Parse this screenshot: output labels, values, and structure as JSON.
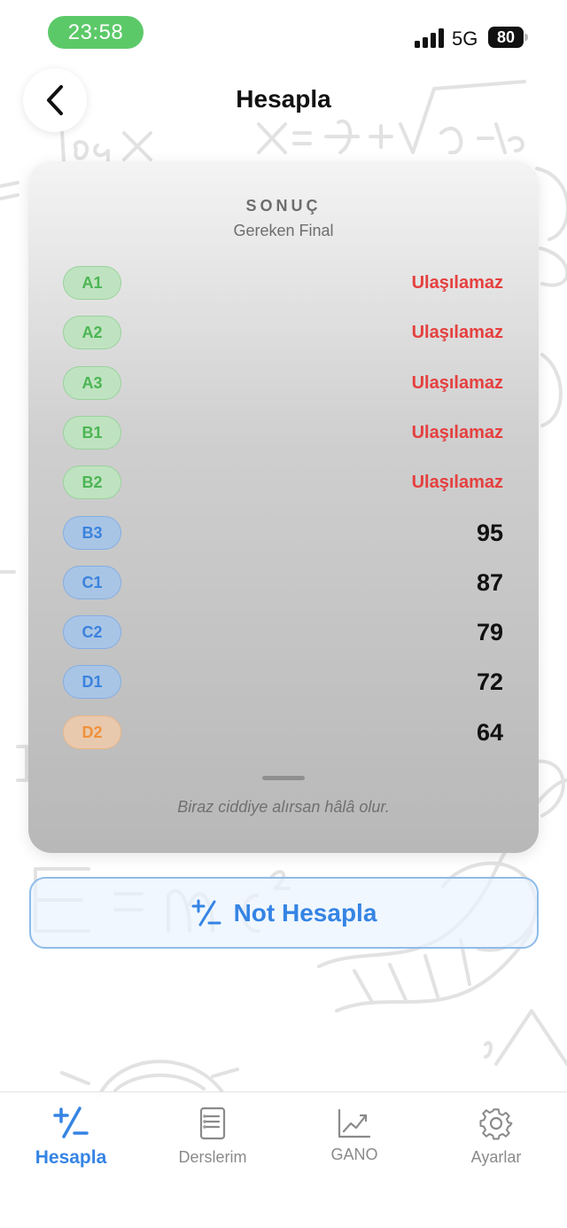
{
  "status_bar": {
    "time": "23:58",
    "network": "5G",
    "battery": "80"
  },
  "nav": {
    "title": "Hesapla"
  },
  "result": {
    "label": "SONUÇ",
    "subtitle": "Gereken Final",
    "rows": [
      {
        "grade": "A1",
        "value": "Ulaşılamaz",
        "tier": "green"
      },
      {
        "grade": "A2",
        "value": "Ulaşılamaz",
        "tier": "green"
      },
      {
        "grade": "A3",
        "value": "Ulaşılamaz",
        "tier": "green"
      },
      {
        "grade": "B1",
        "value": "Ulaşılamaz",
        "tier": "green"
      },
      {
        "grade": "B2",
        "value": "Ulaşılamaz",
        "tier": "green"
      },
      {
        "grade": "B3",
        "value": "95",
        "tier": "blue"
      },
      {
        "grade": "C1",
        "value": "87",
        "tier": "blue"
      },
      {
        "grade": "C2",
        "value": "79",
        "tier": "blue"
      },
      {
        "grade": "D1",
        "value": "72",
        "tier": "blue"
      },
      {
        "grade": "D2",
        "value": "64",
        "tier": "orange"
      }
    ],
    "note": "Biraz ciddiye alırsan hâlâ olur."
  },
  "calc_button": {
    "label": "Not Hesapla",
    "icon": "plus-minus-icon"
  },
  "tabs": [
    {
      "label": "Hesapla",
      "icon": "plus-minus-icon",
      "active": true
    },
    {
      "label": "Derslerim",
      "icon": "notebook-icon",
      "active": false
    },
    {
      "label": "GANO",
      "icon": "trend-chart-icon",
      "active": false
    },
    {
      "label": "Ayarlar",
      "icon": "gear-icon",
      "active": false
    }
  ],
  "colors": {
    "accent": "#3584e4",
    "unreachable": "#e5403f",
    "time_pill": "#5cc968",
    "badge_green_bg": "#bfe3c0",
    "badge_green_text": "#4cb554",
    "badge_blue_bg": "#a9c5e6",
    "badge_blue_text": "#3a82dd",
    "badge_orange_bg": "#e9c9ae",
    "badge_orange_text": "#f0913a"
  }
}
